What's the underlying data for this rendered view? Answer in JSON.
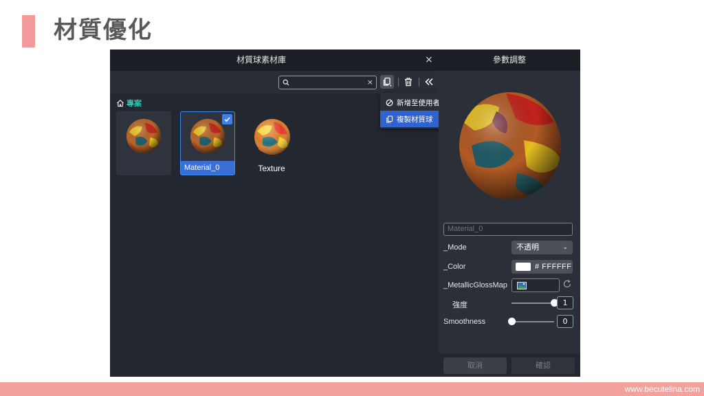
{
  "slide": {
    "title": "材質優化",
    "footer_url": "www.becutelina.com"
  },
  "library": {
    "title": "材質球素材庫",
    "close": "×",
    "search_value": "",
    "search_clear": "×",
    "breadcrumb": "專案",
    "items": [
      {
        "label": "",
        "selected": false
      },
      {
        "label": "Material_0",
        "selected": true
      },
      {
        "label": "Texture",
        "selected": false
      }
    ],
    "menu": [
      {
        "label": "新增至使用者材質球",
        "icon": "no-entry-icon"
      },
      {
        "label": "複製材質球",
        "icon": "copy-icon"
      }
    ]
  },
  "params": {
    "title": "參數調整",
    "name_placeholder": "Material_0",
    "mode_label": "_Mode",
    "mode_value": "不透明",
    "color_label": "_Color",
    "color_hex": "# FFFFFF",
    "metallic_label": "_MetallicGlossMap",
    "strength_label": "強度",
    "strength_value": "1",
    "strength_fraction": 1,
    "smoothness_label": "Smoothness",
    "smoothness_value": "0",
    "smoothness_fraction": 0,
    "cancel_label": "取消",
    "confirm_label": "確認"
  },
  "colors": {
    "accent": "#f39a9a",
    "selection": "#3a6fd8",
    "breadcrumb": "#2ec8b0",
    "swatch": "#ffffff"
  }
}
